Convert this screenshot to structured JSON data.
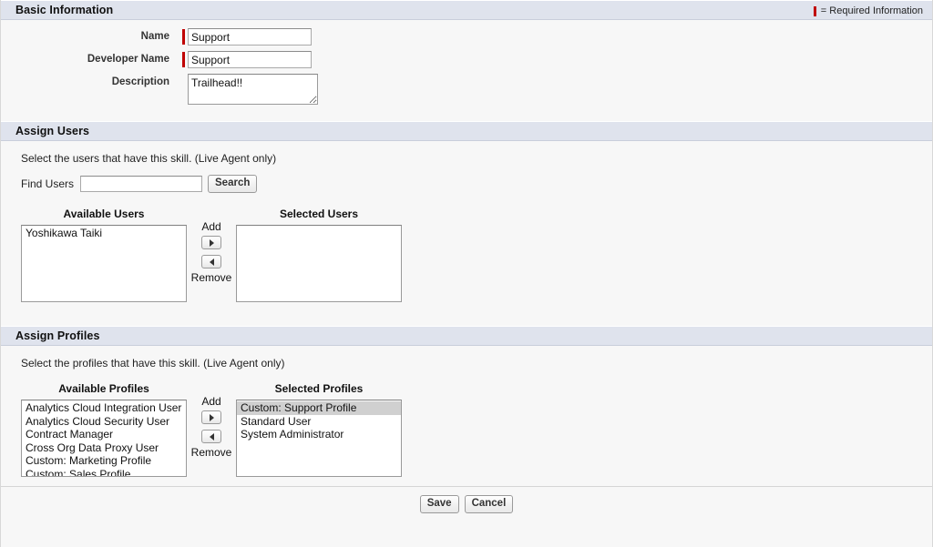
{
  "legend": {
    "required_text": "= Required Information"
  },
  "sections": {
    "basic": {
      "title": "Basic Information",
      "fields": {
        "name": {
          "label": "Name",
          "value": "Support",
          "required": true
        },
        "developer_name": {
          "label": "Developer Name",
          "value": "Support",
          "required": true
        },
        "description": {
          "label": "Description",
          "value": "Trailhead!!",
          "required": false
        }
      }
    },
    "assign_users": {
      "title": "Assign Users",
      "hint": "Select the users that have this skill. (Live Agent only)",
      "find_label": "Find Users",
      "find_value": "",
      "find_placeholder": "",
      "search_label": "Search",
      "available_title": "Available Users",
      "selected_title": "Selected Users",
      "add_label": "Add",
      "remove_label": "Remove",
      "available": [
        "Yoshikawa Taiki"
      ],
      "selected": []
    },
    "assign_profiles": {
      "title": "Assign Profiles",
      "hint": "Select the profiles that have this skill. (Live Agent only)",
      "available_title": "Available Profiles",
      "selected_title": "Selected Profiles",
      "add_label": "Add",
      "remove_label": "Remove",
      "available": [
        "Analytics Cloud Integration User",
        "Analytics Cloud Security User",
        "Contract Manager",
        "Cross Org Data Proxy User",
        "Custom: Marketing Profile",
        "Custom: Sales Profile"
      ],
      "selected": [
        "Custom: Support Profile",
        "Standard User",
        "System Administrator"
      ],
      "selected_highlighted_index": 0
    }
  },
  "footer": {
    "save_label": "Save",
    "cancel_label": "Cancel"
  },
  "colors": {
    "section_header_bg": "#dfe3ed",
    "required_marker": "#c00000",
    "page_bg": "#f7f7f7",
    "list_selected_bg": "#d0d0d0"
  }
}
